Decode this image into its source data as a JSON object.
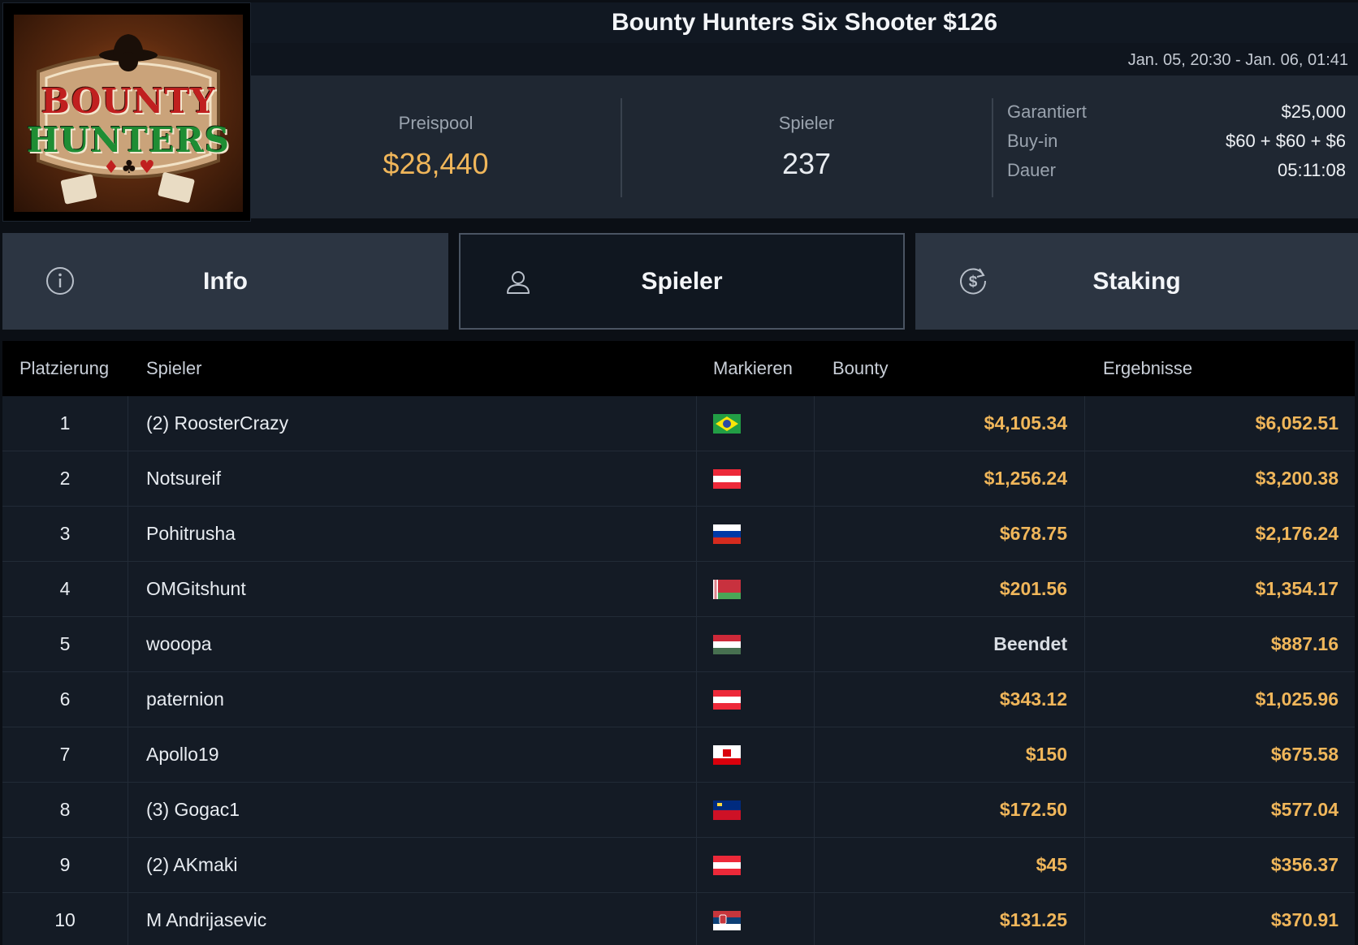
{
  "tournament": {
    "title": "Bounty Hunters Six Shooter $126",
    "dates": "Jan. 05, 20:30 - Jan. 06, 01:41",
    "logo_text_top": "BOUNTY",
    "logo_text_bottom": "HUNTERS"
  },
  "stats": {
    "prizepool_label": "Preispool",
    "prizepool_value": "$28,440",
    "players_label": "Spieler",
    "players_value": "237"
  },
  "details": [
    {
      "key": "Garantiert",
      "value": "$25,000"
    },
    {
      "key": "Buy-in",
      "value": "$60 + $60 + $6"
    },
    {
      "key": "Dauer",
      "value": "05:11:08"
    }
  ],
  "tabs": {
    "info": "Info",
    "players": "Spieler",
    "staking": "Staking",
    "active": "players"
  },
  "table": {
    "headers": {
      "place": "Platzierung",
      "player": "Spieler",
      "flag": "Markieren",
      "bounty": "Bounty",
      "results": "Ergebnisse"
    },
    "rows": [
      {
        "place": "1",
        "player": "(2) RoosterCrazy",
        "flag": "brazil-flag-icon",
        "bounty": "$4,105.34",
        "result": "$6,052.51"
      },
      {
        "place": "2",
        "player": "Notsureif",
        "flag": "austria-flag-icon",
        "bounty": "$1,256.24",
        "result": "$3,200.38"
      },
      {
        "place": "3",
        "player": "Pohitrusha",
        "flag": "russia-flag-icon",
        "bounty": "$678.75",
        "result": "$2,176.24"
      },
      {
        "place": "4",
        "player": "OMGitshunt",
        "flag": "belarus-flag-icon",
        "bounty": "$201.56",
        "result": "$1,354.17"
      },
      {
        "place": "5",
        "player": "wooopa",
        "flag": "hungary-flag-icon",
        "bounty": "Beendet",
        "result": "$887.16"
      },
      {
        "place": "6",
        "player": "paternion",
        "flag": "austria-flag-icon",
        "bounty": "$343.12",
        "result": "$1,025.96"
      },
      {
        "place": "7",
        "player": "Apollo19",
        "flag": "gibraltar-flag-icon",
        "bounty": "$150",
        "result": "$675.58"
      },
      {
        "place": "8",
        "player": "(3) Gogac1",
        "flag": "liechtenstein-flag-icon",
        "bounty": "$172.50",
        "result": "$577.04"
      },
      {
        "place": "9",
        "player": "(2) AKmaki",
        "flag": "austria-flag-icon",
        "bounty": "$45",
        "result": "$356.37"
      },
      {
        "place": "10",
        "player": "M Andrijasevic",
        "flag": "serbia-flag-icon",
        "bounty": "$131.25",
        "result": "$370.91"
      }
    ]
  },
  "colors": {
    "accent_gold": "#f0b65a",
    "background": "#0b0f15",
    "row_background": "#141b25"
  }
}
